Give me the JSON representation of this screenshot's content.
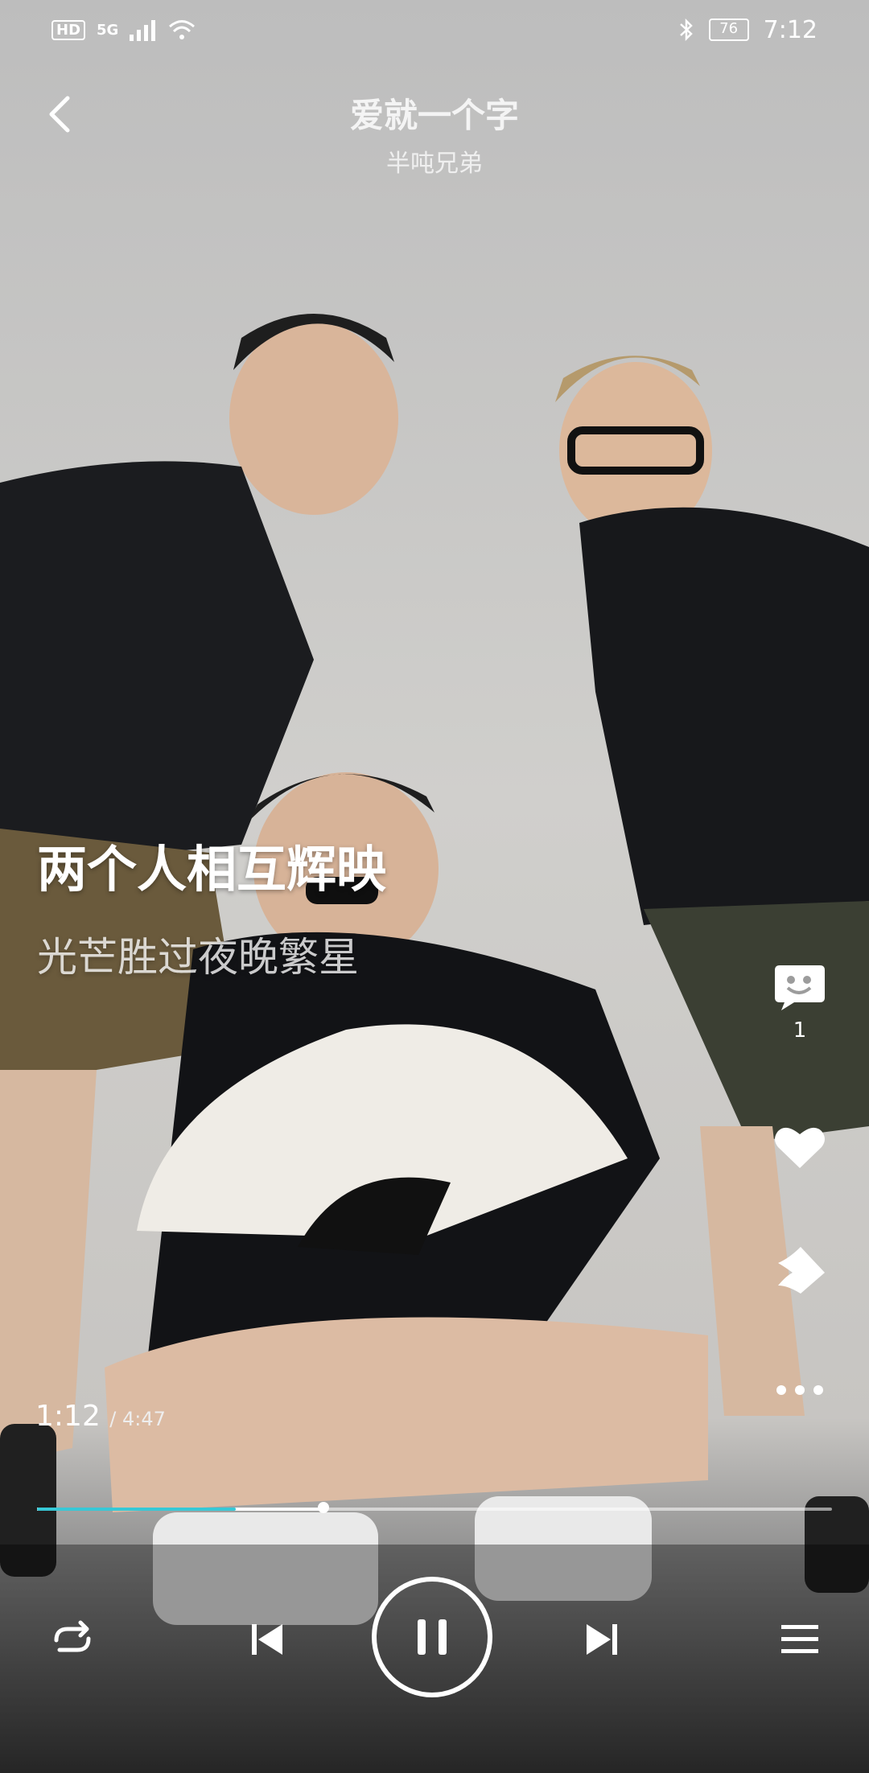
{
  "status_bar": {
    "hd_badge": "HD",
    "network": "5G",
    "battery_level": "76",
    "time": "7:12"
  },
  "header": {
    "song_title": "爱就一个字",
    "artist": "半吨兄弟"
  },
  "lyrics": {
    "current_line": "两个人相互辉映",
    "next_line": "光芒胜过夜晚繁星"
  },
  "side_actions": {
    "comment_count": "1"
  },
  "playback": {
    "elapsed": "1:12",
    "duration": "/ 4:47",
    "progress_fraction": 0.25,
    "buffer_fraction": 0.36
  },
  "colors": {
    "progress_accent": "#37c8d6"
  },
  "icons": {
    "back": "chevron-left-icon",
    "comment": "comment-bubble-icon",
    "like": "heart-icon",
    "share": "share-icon",
    "more": "more-dots-icon",
    "repeat": "repeat-icon",
    "previous": "previous-track-icon",
    "pause": "pause-icon",
    "next": "next-track-icon",
    "playlist": "playlist-icon"
  }
}
